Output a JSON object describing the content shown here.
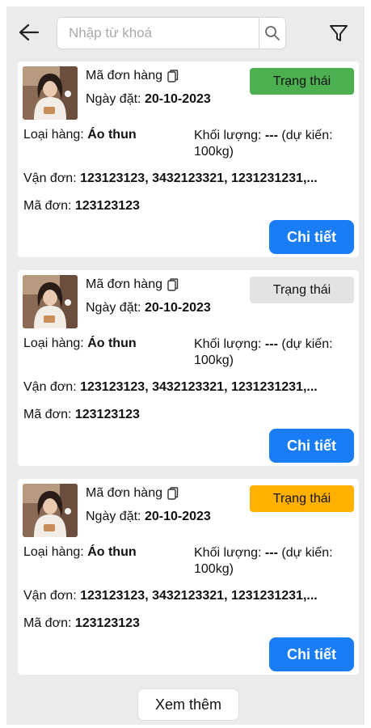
{
  "colors": {
    "status_green": "#4caf50",
    "status_gray": "#e3e3e3",
    "status_orange": "#ffb000",
    "primary": "#1a7df5"
  },
  "header": {
    "back_icon": "arrow-left-icon",
    "search_placeholder": "Nhập từ khoá",
    "search_value": "",
    "search_icon": "search-icon",
    "filter_icon": "funnel-icon"
  },
  "orders": [
    {
      "code_label": "Mã đơn hàng",
      "date_label": "Ngày đặt:",
      "date_value": "20-10-2023",
      "status": "Trạng thái",
      "status_color": "#4caf50",
      "type_label": "Loại hàng:",
      "type_value": "Áo thun",
      "weight_label": "Khối lượng:",
      "weight_value": "---",
      "weight_note": "(dự kiến: 100kg)",
      "waybill_label": "Vận đơn:",
      "waybill_value": "123123123, 3432123321, 1231231231,...",
      "order_label": "Mã đơn:",
      "order_value": "123123123",
      "detail_label": "Chi tiết"
    },
    {
      "code_label": "Mã đơn hàng",
      "date_label": "Ngày đặt:",
      "date_value": "20-10-2023",
      "status": "Trạng thái",
      "status_color": "#e3e3e3",
      "type_label": "Loại hàng:",
      "type_value": "Áo thun",
      "weight_label": "Khối lượng:",
      "weight_value": "---",
      "weight_note": "(dự kiến: 100kg)",
      "waybill_label": "Vận đơn:",
      "waybill_value": "123123123, 3432123321, 1231231231,...",
      "order_label": "Mã đơn:",
      "order_value": "123123123",
      "detail_label": "Chi tiết"
    },
    {
      "code_label": "Mã đơn hàng",
      "date_label": "Ngày đặt:",
      "date_value": "20-10-2023",
      "status": "Trạng thái",
      "status_color": "#ffb000",
      "type_label": "Loại hàng:",
      "type_value": "Áo thun",
      "weight_label": "Khối lượng:",
      "weight_value": "---",
      "weight_note": "(dự kiến: 100kg)",
      "waybill_label": "Vận đơn:",
      "waybill_value": "123123123, 3432123321, 1231231231,...",
      "order_label": "Mã đơn:",
      "order_value": "123123123",
      "detail_label": "Chi tiết"
    }
  ],
  "footer": {
    "more_label": "Xem thêm"
  }
}
